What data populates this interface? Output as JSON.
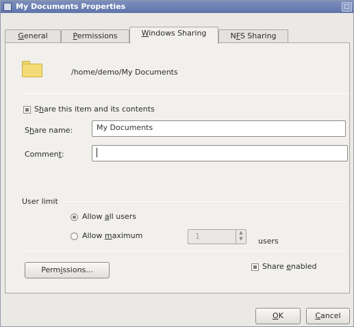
{
  "window": {
    "title": "My Documents Properties",
    "close_glyph": "□"
  },
  "tabs": [
    {
      "label": "General",
      "mnemonic": "G",
      "rest": "eneral"
    },
    {
      "label": "Permissions",
      "mnemonic": "P",
      "rest": "ermissions"
    },
    {
      "label": "Windows Sharing",
      "mnemonic": "W",
      "rest": "indows Sharing",
      "active": true
    },
    {
      "label": "NFS Sharing",
      "pre": "N",
      "mnemonic": "F",
      "rest": "S Sharing"
    }
  ],
  "panel": {
    "folder_icon": "folder-icon",
    "path": "/home/demo/My Documents",
    "share_checkbox": {
      "pre": "S",
      "mnemonic": "h",
      "rest": "are this item and its contents",
      "checked": true
    },
    "share_name": {
      "pre": "S",
      "mnemonic": "h",
      "rest": "are name:",
      "value": "My Documents"
    },
    "comment": {
      "pre": "Commen",
      "mnemonic": "t",
      "rest": ":",
      "value": ""
    },
    "user_limit": {
      "title": "User limit",
      "allow_all": {
        "pre": "Allow ",
        "mnemonic": "a",
        "rest": "ll users",
        "checked": true
      },
      "allow_max": {
        "pre": "Allow ",
        "mnemonic": "m",
        "rest": "aximum",
        "checked": false
      },
      "max_value": "1",
      "users_suffix": "users"
    },
    "permissions_button": {
      "pre": "Perm",
      "mnemonic": "i",
      "rest": "ssions..."
    },
    "share_enabled": {
      "pre": "Share ",
      "mnemonic": "e",
      "rest": "nabled",
      "checked": true
    }
  },
  "footer": {
    "ok": {
      "mnemonic": "O",
      "rest": "K"
    },
    "cancel": {
      "mnemonic": "C",
      "rest": "ancel"
    }
  }
}
